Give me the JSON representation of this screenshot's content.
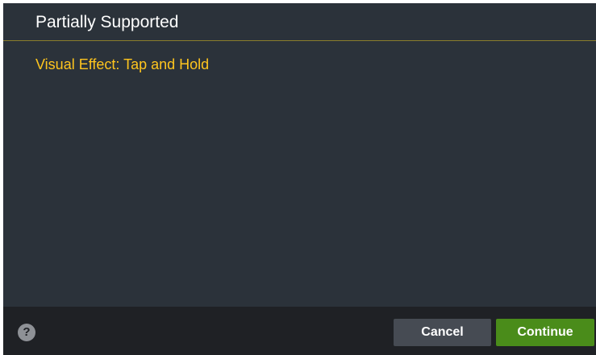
{
  "dialog": {
    "title": "Partially Supported",
    "message": "Visual Effect: Tap and Hold"
  },
  "footer": {
    "help_glyph": "?",
    "help_icon": "question-circle-icon",
    "cancel_label": "Cancel",
    "continue_label": "Continue"
  },
  "colors": {
    "background": "#2b323a",
    "footer_background": "#1f2125",
    "accent_text": "#ffc51e",
    "divider": "#8a7d2c",
    "cancel_button": "#464b53",
    "continue_button": "#4a8c1a"
  }
}
